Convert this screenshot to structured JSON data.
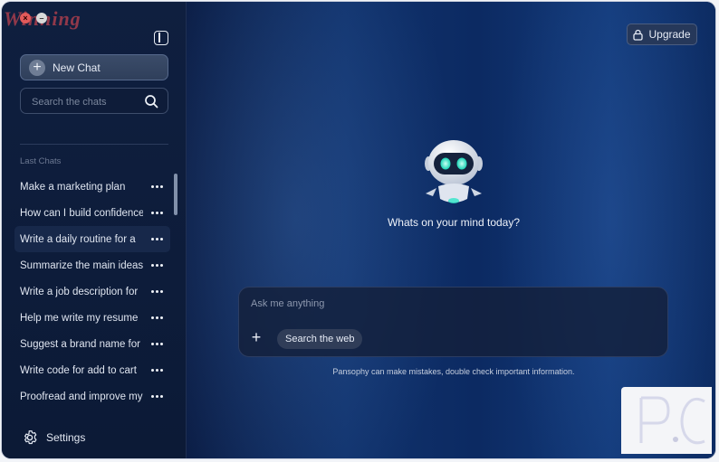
{
  "watermark": "Winning",
  "sidebar": {
    "new_chat_label": "New Chat",
    "search_placeholder": "Search the chats",
    "section_label": "Last Chats",
    "chats": [
      "Make a marketing plan",
      "How can I build confidence",
      "Write a daily routine for a",
      "Summarize the main ideas",
      "Write a job description for",
      "Help me write my resume",
      "Suggest a brand name for",
      "Write code for add to cart",
      "Proofread and improve my"
    ],
    "settings_label": "Settings"
  },
  "header": {
    "upgrade_label": "Upgrade"
  },
  "main": {
    "greeting": "Whats on your mind today?",
    "input_placeholder": "Ask me anything",
    "search_web_label": "Search the web",
    "disclaimer": "Pansophy can make mistakes, double check important information."
  },
  "corner_logo_text": "P.C",
  "colors": {
    "accent_eyes": "#2ee6c8",
    "sidebar_bg": "#0f1f3f",
    "main_bg": "#10326c"
  }
}
